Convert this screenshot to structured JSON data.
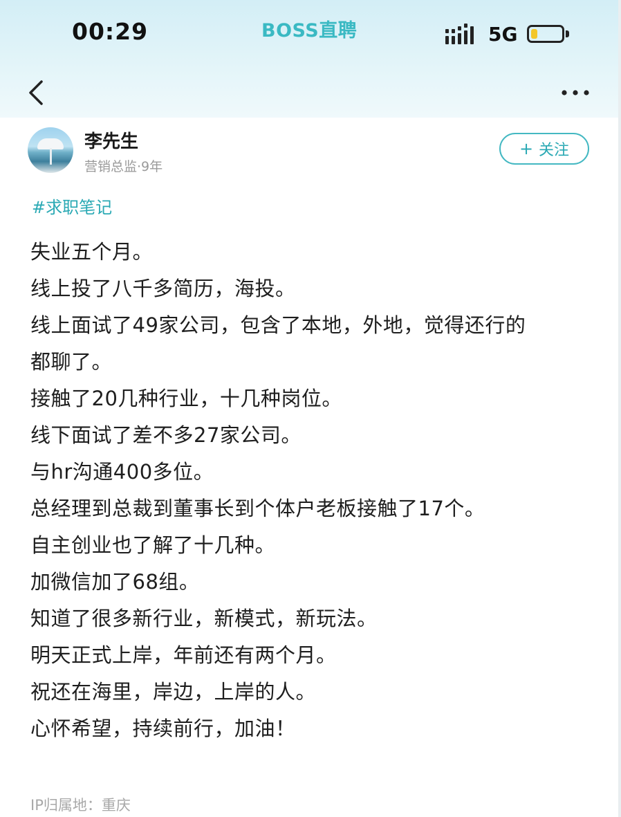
{
  "status_bar": {
    "time": "00:29",
    "app_brand": "BOSS直聘",
    "network": "5G",
    "battery_level": 0.22,
    "battery_color": "#f3c72a"
  },
  "nav": {
    "back_icon": "chevron-left-icon",
    "more_icon": "more-dots-icon"
  },
  "author": {
    "name": "李先生",
    "meta": "营销总监·9年",
    "follow_label": "关注"
  },
  "post": {
    "tag": "#求职笔记",
    "lines": [
      "失业五个月。",
      "线上投了八千多简历，海投。",
      "线上面试了49家公司，包含了本地，外地，觉得还行的",
      "都聊了。",
      "接触了20几种行业，十几种岗位。",
      "线下面试了差不多27家公司。",
      "与hr沟通400多位。",
      "总经理到总裁到董事长到个体户老板接触了17个。",
      "自主创业也了解了十几种。",
      "加微信加了68组。",
      "知道了很多新行业，新模式，新玩法。",
      "明天正式上岸，年前还有两个月。",
      "祝还在海里，岸边，上岸的人。",
      "心怀希望，持续前行，加油！"
    ],
    "ip_location": "IP归属地：重庆"
  },
  "colors": {
    "accent": "#2aa9b4",
    "brand": "#3ab9c3",
    "header_bg": "#d3eef6"
  }
}
